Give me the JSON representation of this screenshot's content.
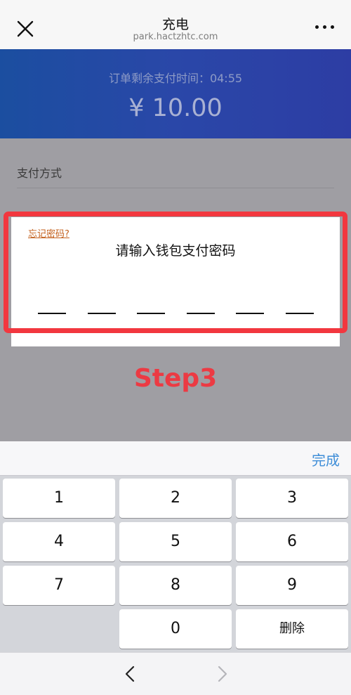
{
  "header": {
    "title": "充电",
    "url": "park.hactzhtc.com",
    "close_icon": "close-icon",
    "more_icon": "more-dots-icon"
  },
  "payment": {
    "countdown_text": "订单剩余支付时间：04:55",
    "amount": "¥ 10.00",
    "method_label": "支付方式"
  },
  "password_dialog": {
    "forgot_link": "忘记密码?",
    "prompt": "请输入钱包支付密码",
    "digit_count": 6
  },
  "annotation": {
    "step_label": "Step3",
    "highlight_color": "#f2373f"
  },
  "keyboard": {
    "done_label": "完成",
    "keys": [
      "1",
      "2",
      "3",
      "4",
      "5",
      "6",
      "7",
      "8",
      "9",
      "",
      "0",
      "删除"
    ]
  },
  "bottom_nav": {
    "back_icon": "chevron-left-icon",
    "forward_icon": "chevron-right-icon"
  },
  "colors": {
    "header_blue": "#2a47a8",
    "link_orange": "#c4621f",
    "done_blue": "#3f8ed8"
  }
}
